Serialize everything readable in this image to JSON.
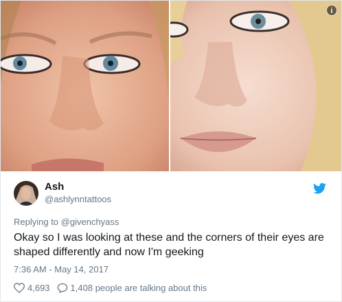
{
  "tweet": {
    "name": "Ash",
    "handle": "@ashlynntattoos",
    "replying_prefix": "Replying to",
    "replying_to": "@givenchyass",
    "text": "Okay so I was looking at these and the corners of their eyes are shaped differently and now I'm geeking",
    "timestamp": "7:36 AM - May 14, 2017",
    "likes": "4,693",
    "replies_text": "1,408 people are talking about this"
  },
  "icons": {
    "info": "info-icon",
    "twitter": "twitter-bird-icon",
    "like": "heart-icon",
    "reply": "speech-bubble-icon"
  },
  "colors": {
    "twitter_blue": "#1da1f2",
    "secondary_text": "#657786",
    "primary_text": "#14171a"
  }
}
